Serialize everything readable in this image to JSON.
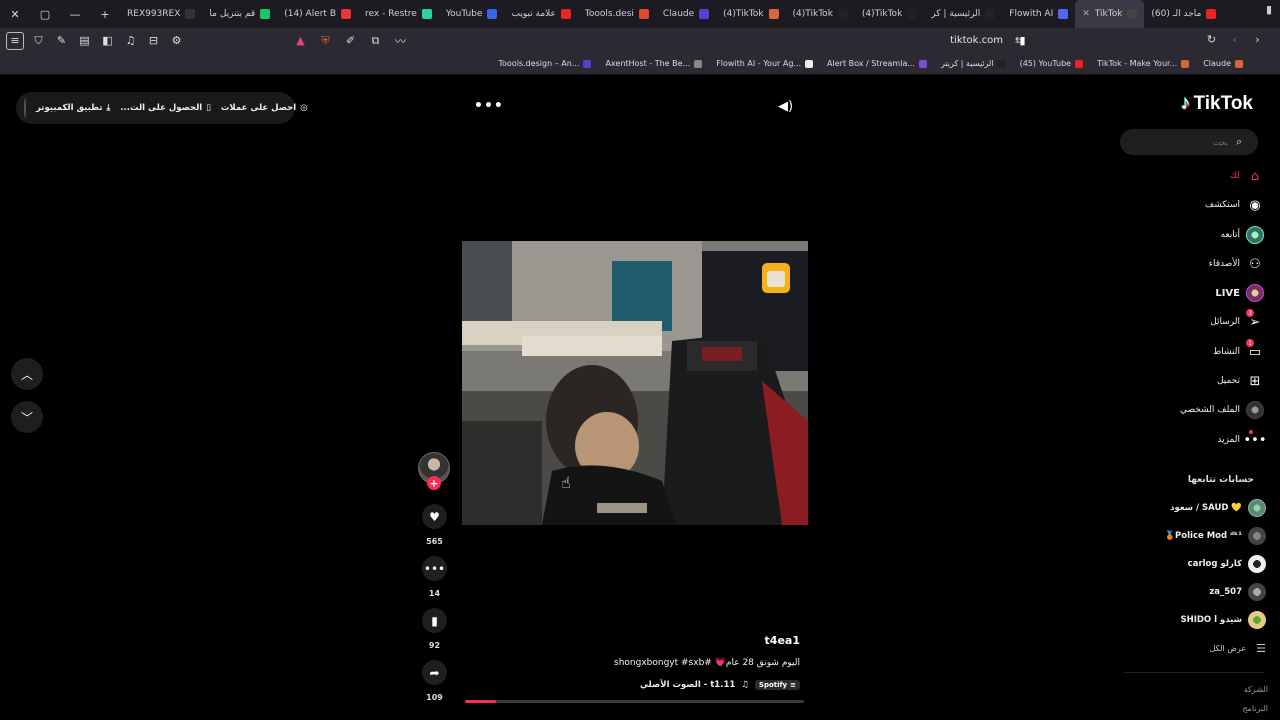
{
  "browser": {
    "tabs": [
      {
        "label": "REX993REX",
        "color": "#333"
      },
      {
        "label": "قم بتنزيل ما",
        "color": "#18c96b"
      },
      {
        "label": "(14) Alert B",
        "color": "#e33"
      },
      {
        "label": "rex - Restre",
        "color": "#2bd4a0"
      },
      {
        "label": "YouTube",
        "color": "#3568e8"
      },
      {
        "label": "علامة تبويب",
        "color": "#e22"
      },
      {
        "label": "Toools.desi",
        "color": "#e04a2b"
      },
      {
        "label": "Claude",
        "color": "#5a3fd6"
      },
      {
        "label": "(4)TikTok",
        "color": "#d9653b"
      },
      {
        "label": "(4)TikTok",
        "color": "#222"
      },
      {
        "label": "(4)TikTok",
        "color": "#222"
      },
      {
        "label": "الرئيسية | كر",
        "color": "#222"
      },
      {
        "label": "Flowith AI",
        "color": "#5566ee"
      },
      {
        "label": "TikTok",
        "color": "#444"
      },
      {
        "label": "(60) ماجد الـ",
        "color": "#e22"
      }
    ],
    "active_tab_index": 13,
    "url": "tiktok.com",
    "bookmarks": [
      {
        "label": "Toools.design – An...",
        "color": "#5a3fd6"
      },
      {
        "label": "AxentHost - The Be...",
        "color": "#888"
      },
      {
        "label": "Flowith AI - Your Ag...",
        "color": "#eee"
      },
      {
        "label": "Alert Box / Streamla...",
        "color": "#7a4fd6"
      },
      {
        "label": "الرئيسية | كريتر",
        "color": "#222"
      },
      {
        "label": "(45) YouTube",
        "color": "#e22"
      },
      {
        "label": "TikTok - Make Your...",
        "color": "#d9653b"
      },
      {
        "label": "Claude",
        "color": "#d9653b"
      }
    ]
  },
  "header": {
    "pill_items": [
      "احصل على عملات",
      "الحصول على الت...",
      "تطبيق الكمبيوتر"
    ],
    "logo_text": "TikTok"
  },
  "search": {
    "placeholder": "بحث"
  },
  "nav": [
    {
      "label": "لك",
      "icon": "home-icon",
      "active": true
    },
    {
      "label": "استكشف",
      "icon": "compass-icon"
    },
    {
      "label": "أتابعه",
      "icon": "avatar"
    },
    {
      "label": "الأصدقاء",
      "icon": "friends-icon"
    },
    {
      "label": "LIVE",
      "icon": "live-avatar"
    },
    {
      "label": "الرسائل",
      "icon": "paper-plane-icon",
      "badge": "3"
    },
    {
      "label": "النشاط",
      "icon": "activity-icon",
      "badge": "1"
    },
    {
      "label": "تحميل",
      "icon": "upload-icon"
    },
    {
      "label": "الملف الشخصي",
      "icon": "profile-avatar"
    },
    {
      "label": "المزيد",
      "icon": "more-icon"
    }
  ],
  "following": {
    "title": "حسابات تتابعها",
    "accounts": [
      {
        "name": "سعود / SAUD 💛",
        "color": "#5a8a6a"
      },
      {
        "name": "🥉Police Mod ᵈᵏ¹",
        "color": "#666"
      },
      {
        "name": "carlog كارلو",
        "color": "#ddd"
      },
      {
        "name": "za_507",
        "color": "#555"
      },
      {
        "name": "SHIDO l شيدو",
        "color": "#c9a25c"
      }
    ],
    "see_all": "عرض الكل"
  },
  "footer": {
    "company": "الشركة",
    "program": "البرنامج"
  },
  "video": {
    "author": "t4ea1",
    "caption": "اليوم شونق 28 عام💗 #shongxbongyt #sxb",
    "music": "الصوت الأصلي - t1.11",
    "spotify_label": "Spotify",
    "likes": "565",
    "comments": "14",
    "saves": "92",
    "shares": "109",
    "progress": 0.09
  }
}
